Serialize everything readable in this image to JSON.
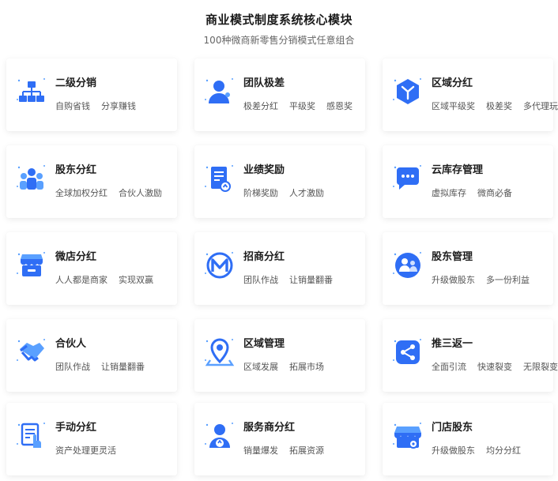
{
  "header": {
    "title": "商业模式制度系统核心模块",
    "subtitle": "100种微商新零售分销模式任意组合"
  },
  "colors": {
    "accent": "#2f6ef5",
    "accent_light": "#5aa0ff"
  },
  "modules": [
    {
      "title": "二级分销",
      "icon": "hierarchy-icon",
      "desc": [
        "自购省钱",
        "分享赚钱"
      ]
    },
    {
      "title": "团队极差",
      "icon": "person-icon",
      "desc": [
        "极差分红",
        "平级奖",
        "感恩奖"
      ]
    },
    {
      "title": "区域分红",
      "icon": "cube-icon",
      "desc": [
        "区域平级奖",
        "极差奖",
        "多代理玩法"
      ]
    },
    {
      "title": "股东分红",
      "icon": "group-icon",
      "desc": [
        "全球加权分红",
        "合伙人激励"
      ]
    },
    {
      "title": "业绩奖励",
      "icon": "document-icon",
      "desc": [
        "阶梯奖励",
        "人才激励"
      ]
    },
    {
      "title": "云库存管理",
      "icon": "chat-bubble-icon",
      "desc": [
        "虚拟库存",
        "微商必备"
      ]
    },
    {
      "title": "微店分红",
      "icon": "store-icon",
      "desc": [
        "人人都是商家",
        "实现双赢"
      ]
    },
    {
      "title": "招商分红",
      "icon": "m-logo-icon",
      "desc": [
        "团队作战",
        "让销量翻番"
      ]
    },
    {
      "title": "股东管理",
      "icon": "users-circle-icon",
      "desc": [
        "升级做股东",
        "多一份利益"
      ]
    },
    {
      "title": "合伙人",
      "icon": "handshake-icon",
      "desc": [
        "团队作战",
        "让销量翻番"
      ]
    },
    {
      "title": "区域管理",
      "icon": "location-pin-icon",
      "desc": [
        "区域发展",
        "拓展市场"
      ]
    },
    {
      "title": "推三返一",
      "icon": "share-icon",
      "desc": [
        "全面引流",
        "快速裂变",
        "无限裂变"
      ]
    },
    {
      "title": "手动分红",
      "icon": "hand-document-icon",
      "desc": [
        "资产处理更灵活"
      ]
    },
    {
      "title": "服务商分红",
      "icon": "service-person-icon",
      "desc": [
        "销量爆发",
        "拓展资源"
      ]
    },
    {
      "title": "门店股东",
      "icon": "shop-icon",
      "desc": [
        "升级做股东",
        "均分分红"
      ]
    }
  ]
}
